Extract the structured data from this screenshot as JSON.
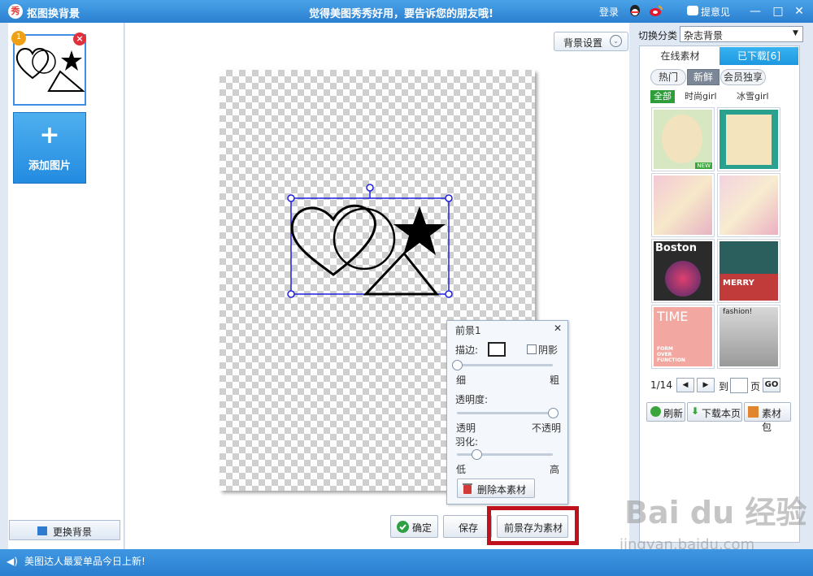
{
  "titlebar": {
    "app_logo": "秀",
    "app_title": "抠图换背景",
    "slogan": "觉得美图秀秀好用，要告诉您的朋友哦!",
    "login": "登录",
    "feedback": "提意见",
    "minimize": "—",
    "maximize": "□",
    "close": "✕"
  },
  "left": {
    "thumb_index": "1",
    "delete_glyph": "×",
    "add_plus": "+",
    "add_image": "添加图片",
    "change_bg": "更换背景"
  },
  "center": {
    "bg_settings": "背景设置",
    "chevron": "⌄"
  },
  "fg_panel": {
    "title": "前景1",
    "close": "✕",
    "stroke_label": "描边:",
    "shadow_label": "阴影",
    "thin": "细",
    "thick": "粗",
    "stroke_level": 0.0,
    "opacity_label": "透明度:",
    "transparent": "透明",
    "opaque": "不透明",
    "opacity_level": 1.0,
    "feather_label": "羽化:",
    "low": "低",
    "high": "高",
    "feather_level": 0.2,
    "delete_asset": "删除本素材"
  },
  "actions": {
    "confirm": "确定",
    "save": "保存",
    "save_as_asset": "前景存为素材"
  },
  "right": {
    "category_label": "切换分类",
    "category_value": "杂志背景",
    "tab_online": "在线素材",
    "tab_downloaded": "已下载[6]",
    "pill_hot": "热门",
    "pill_new": "新鲜",
    "pill_vip": "会员独享",
    "sub_all": "全部",
    "sub_fashion": "时尚girl",
    "sub_ice": "冰雪girl",
    "new_badge": "NEW",
    "thumb_texts": {
      "boston": "Boston",
      "merry": "MERRY",
      "time": "TIME",
      "time_sub": "FORM OVER FUNCTION",
      "fashion": "fashion!"
    },
    "page_indicator": "1/14",
    "prev": "◀",
    "next": "▶",
    "goto_label": "到",
    "page_unit": "页",
    "go": "GO",
    "refresh": "刷新",
    "download_page": "下载本页",
    "asset_pack": "素材包"
  },
  "status": {
    "speaker": "◀)",
    "text": "美图达人最爱单品今日上新!"
  },
  "watermark": {
    "brand": "Bai du 经验",
    "url": "jingyan.baidu.com"
  },
  "colors": {
    "title_bar": "#2b7fd0",
    "accent": "#1d98e0",
    "highlight": "#c0121c",
    "selection": "#1f1fe0"
  }
}
